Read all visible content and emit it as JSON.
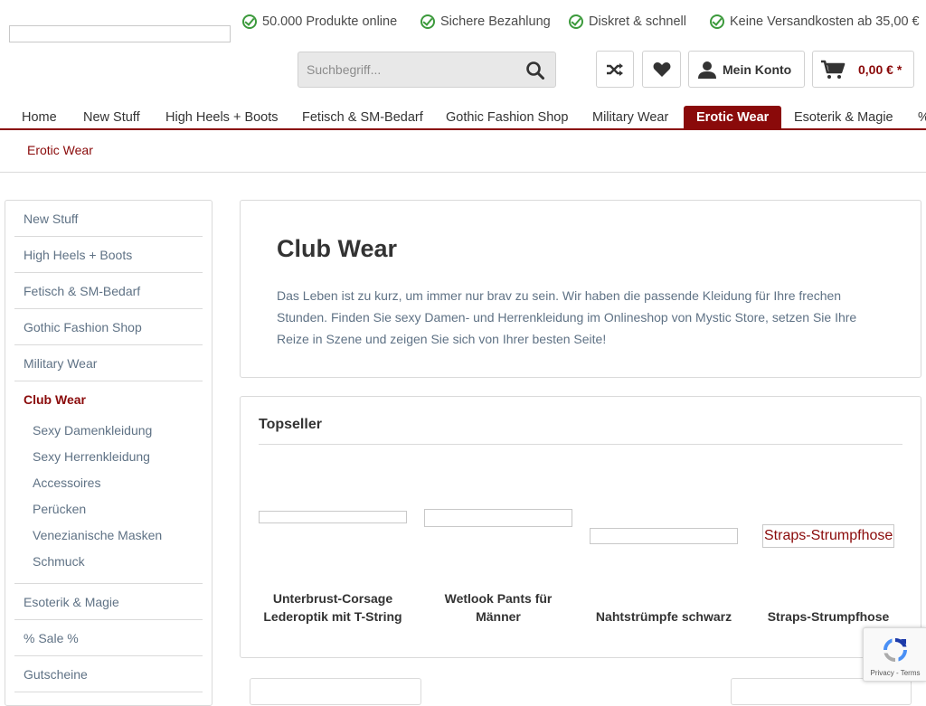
{
  "header": {
    "usps": [
      "50.000 Produkte online",
      "Sichere Bezahlung",
      "Diskret & schnell",
      "Keine Versandkosten ab 35,00 €"
    ],
    "search_placeholder": "Suchbegriff...",
    "account_label": "Mein Konto",
    "cart_amount": "0,00 € *",
    "icons": {
      "compare": "shuffle-icon",
      "wishlist": "heart-icon",
      "account": "user-icon",
      "cart": "cart-icon",
      "search": "search-icon",
      "usp": "check-circle-icon"
    }
  },
  "nav": {
    "items": [
      "Home",
      "New Stuff",
      "High Heels + Boots",
      "Fetisch & SM-Bedarf",
      "Gothic Fashion Shop",
      "Military Wear",
      "Erotic Wear",
      "Esoterik & Magie",
      "%"
    ],
    "active": "Erotic Wear"
  },
  "breadcrumb": "Erotic Wear",
  "sidebar": {
    "items": [
      "New Stuff",
      "High Heels + Boots",
      "Fetisch & SM-Bedarf",
      "Gothic Fashion Shop",
      "Military Wear",
      "Club Wear",
      "Esoterik & Magie",
      "% Sale %",
      "Gutscheine"
    ],
    "active": "Club Wear",
    "subitems": [
      "Sexy Damenkleidung",
      "Sexy Herrenkleidung",
      "Accessoires",
      "Perücken",
      "Venezianische Masken",
      "Schmuck"
    ]
  },
  "category": {
    "title": "Club Wear",
    "description": "Das Leben ist zu kurz, um immer nur brav zu sein. Wir haben die passende Kleidung für Ihre frechen Stunden. Finden Sie sexy Damen- und Herrenkleidung im Onlineshop von Mystic Store, setzen Sie Ihre Reize in Szene und zeigen Sie sich von Ihrer besten Seite!"
  },
  "topseller": {
    "title": "Topseller",
    "products": [
      {
        "name": "Unterbrust-Corsage Lederoptik mit T-String"
      },
      {
        "name": "Wetlook Pants für Männer"
      },
      {
        "name": "Nahtstrümpfe schwarz"
      },
      {
        "name": "Straps-Strumpfhose",
        "alt": "Straps-Strumpfhose"
      }
    ]
  },
  "recaptcha": {
    "label": "Privacy - Terms"
  },
  "colors": {
    "accent": "#8a0a0a",
    "text": "#5f7285",
    "heading": "#333333",
    "check": "#3c9a3c"
  }
}
